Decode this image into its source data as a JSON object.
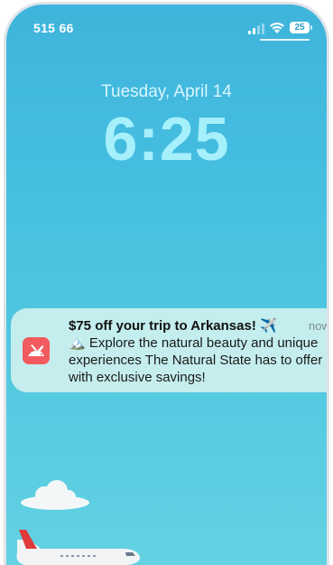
{
  "status_bar": {
    "carrier": "515 66",
    "battery": "25"
  },
  "lock_screen": {
    "date": "Tuesday, April 14",
    "time": "6:25"
  },
  "notification": {
    "app_icon": "rabbit-icon",
    "title": "$75 off your trip to Arkansas! ✈️",
    "time": "now",
    "body": "🏔️ Explore the natural beauty and unique experiences The Natural State has to offer with exclusive savings!"
  },
  "colors": {
    "sky_top": "#3fb4dc",
    "sky_bottom": "#63d2e2",
    "time_text": "#a5f0fb",
    "app_icon_bg": "#f15a5f"
  }
}
